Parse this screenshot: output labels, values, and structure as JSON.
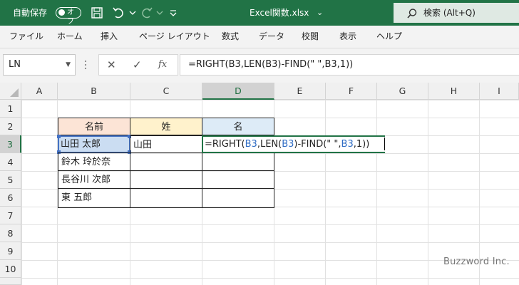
{
  "titlebar": {
    "autosave_label": "自動保存",
    "autosave_state": "オフ",
    "filename": "Excel関数.xlsx",
    "filename_dropdown": "⌄",
    "search_label": "検索 (Alt+Q)",
    "bg_color": "#217346"
  },
  "menu": {
    "items": [
      "ファイル",
      "ホーム",
      "挿入",
      "ページ レイアウト",
      "数式",
      "データ",
      "校閲",
      "表示",
      "ヘルプ"
    ]
  },
  "formula_bar": {
    "name_box": "LN",
    "cancel": "✕",
    "enter": "✓",
    "fx": "fx",
    "formula": "=RIGHT(B3,LEN(B3)-FIND(\" \",B3,1))"
  },
  "sheet": {
    "columns": [
      "A",
      "B",
      "C",
      "D",
      "E",
      "F",
      "G",
      "H",
      "I"
    ],
    "rows": [
      "1",
      "2",
      "3",
      "4",
      "5",
      "6",
      "7",
      "8",
      "9",
      "10"
    ],
    "table": {
      "headers": [
        "名前",
        "姓",
        "名"
      ],
      "header_colors": [
        "#fce4d6",
        "#fff2cc",
        "#ddebf7"
      ],
      "names": [
        "山田 太郎",
        "鈴木 玲於奈",
        "長谷川 次郎",
        "東 五郎"
      ],
      "sei": [
        "山田",
        "",
        "",
        ""
      ]
    },
    "editing": {
      "prefix": "=RIGHT(",
      "ref1": "B3",
      "mid1": ",LEN(",
      "ref2": "B3",
      "mid2": ")-FIND(\" \",",
      "ref3": "B3",
      "suffix": ",1))"
    }
  },
  "watermark": "Buzzword Inc."
}
